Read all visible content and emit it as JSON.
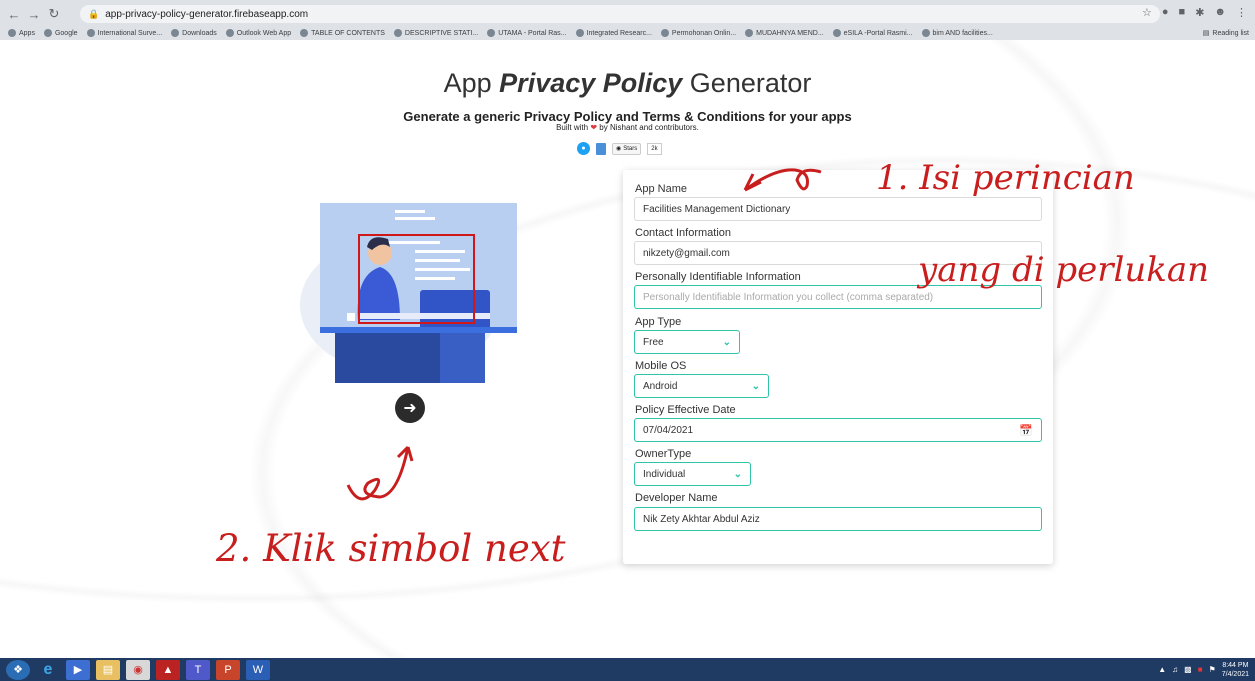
{
  "browser": {
    "url": "app-privacy-policy-generator.firebaseapp.com",
    "bookmarks": [
      {
        "label": "Apps",
        "icon": "apps-grid-icon"
      },
      {
        "label": "Google",
        "icon": "google-icon"
      },
      {
        "label": "International Surve...",
        "icon": "globe-icon"
      },
      {
        "label": "Downloads",
        "icon": "download-icon"
      },
      {
        "label": "Outlook Web App",
        "icon": "outlook-icon"
      },
      {
        "label": "TABLE OF CONTENTS",
        "icon": "globe-icon"
      },
      {
        "label": "DESCRIPTIVE STATI...",
        "icon": "document-icon"
      },
      {
        "label": "UTAMA - Portal Ras...",
        "icon": "portal-icon"
      },
      {
        "label": "Integrated Researc...",
        "icon": "globe-icon"
      },
      {
        "label": "Permohonan Onlin...",
        "icon": "crest-icon"
      },
      {
        "label": "MUDAHNYA MEND...",
        "icon": "circle-icon"
      },
      {
        "label": "eSILA -Portal Rasmi...",
        "icon": "globe-icon"
      },
      {
        "label": "bim AND facilities...",
        "icon": "bookmark-icon"
      }
    ],
    "reading_list": "Reading list"
  },
  "page": {
    "title_prefix": "App ",
    "title_emphasis": "Privacy Policy",
    "title_suffix": " Generator",
    "subtitle": "Generate a generic Privacy Policy and Terms & Conditions for your apps",
    "built_with_prefix": "Built with",
    "built_with_suffix": "by Nishant and contributors.",
    "github_stars_label": "Stars",
    "github_stars_count": "2k"
  },
  "form": {
    "app_name_label": "App Name",
    "app_name_value": "Facilities Management Dictionary",
    "contact_label": "Contact Information",
    "contact_value": "nikzety@gmail.com",
    "pii_label": "Personally Identifiable Information",
    "pii_placeholder": "Personally Identifiable Information you collect (comma separated)",
    "app_type_label": "App Type",
    "app_type_value": "Free",
    "mobile_os_label": "Mobile OS",
    "mobile_os_value": "Android",
    "policy_date_label": "Policy Effective Date",
    "policy_date_value": "07/04/2021",
    "owner_type_label": "OwnerType",
    "owner_type_value": "Individual",
    "developer_name_label": "Developer Name",
    "developer_name_value": "Nik Zety Akhtar Abdul Aziz"
  },
  "annotations": {
    "step1_line1": "1. Isi perincian",
    "step1_line2": "yang di perlukan",
    "step2": "2. Klik simbol next"
  },
  "taskbar": {
    "time": "8:44 PM",
    "date": "7/4/2021"
  },
  "colors": {
    "accent": "#2ec4a7",
    "annotation": "#c81e1e",
    "taskbar": "#1f3b63"
  }
}
